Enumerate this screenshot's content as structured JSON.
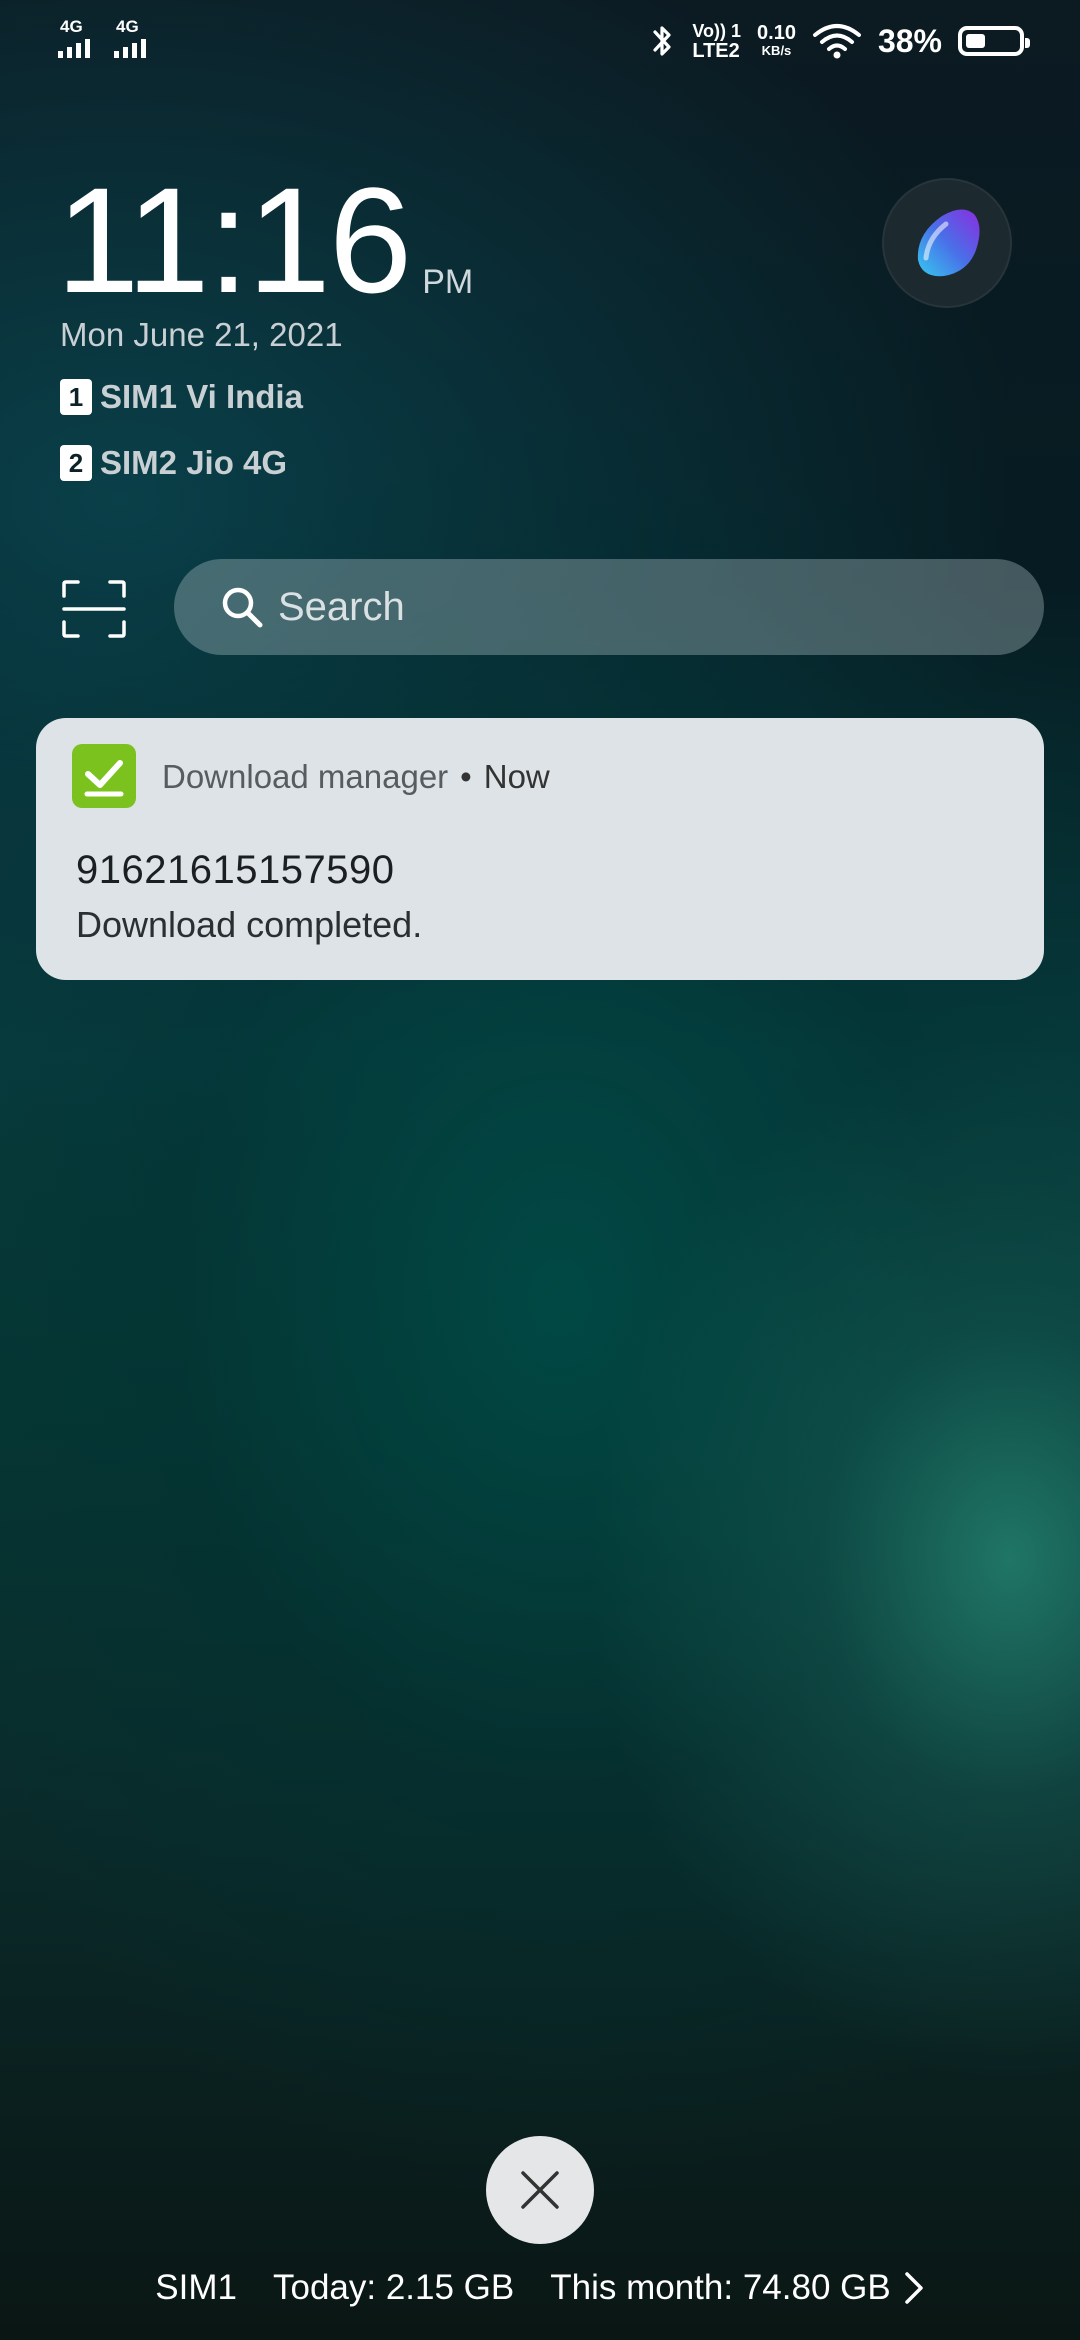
{
  "status_bar": {
    "sim1_network": "4G",
    "sim2_network": "4G",
    "volte_top": "Vo)) 1",
    "volte_bottom": "LTE2",
    "speed_value": "0.10",
    "speed_unit": "KB/s",
    "battery_percent": "38%",
    "battery_level": 0.38
  },
  "lockscreen": {
    "time": "11:16",
    "ampm": "PM",
    "date": "Mon June 21, 2021",
    "sims": [
      {
        "slot": "1",
        "label": "SIM1 Vi India"
      },
      {
        "slot": "2",
        "label": "SIM2 Jio 4G"
      }
    ]
  },
  "search": {
    "placeholder": "Search"
  },
  "notification": {
    "app_name": "Download manager",
    "separator": "•",
    "time": "Now",
    "title": "91621615157590",
    "body": "Download completed.",
    "app_color": "#7cc21f"
  },
  "data_usage": {
    "sim": "SIM1",
    "today": "Today: 2.15 GB",
    "month": "This month: 74.80 GB"
  },
  "icons": {
    "scan": "scan-icon",
    "search": "search-icon",
    "close": "close-icon",
    "assistant": "assistant-icon",
    "chevron": "chevron-right-icon"
  }
}
